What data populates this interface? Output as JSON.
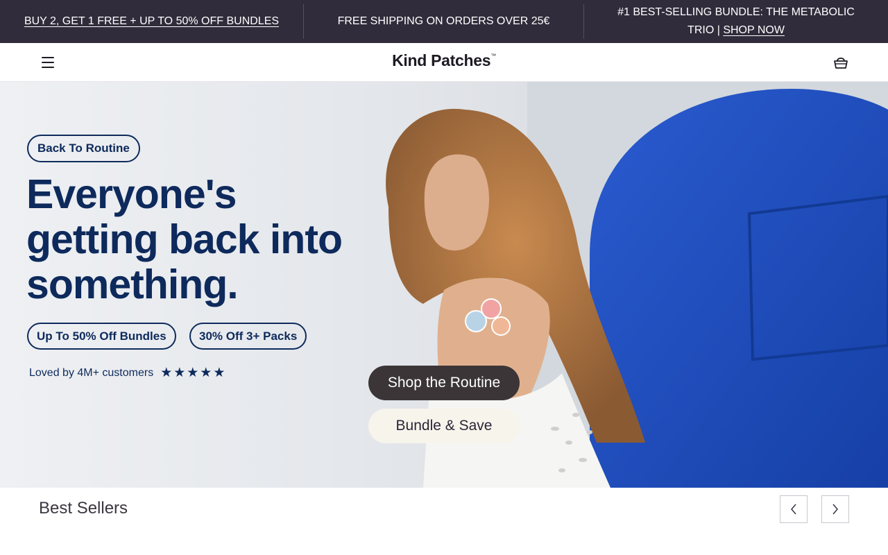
{
  "announcement": {
    "item1": "BUY 2, GET 1 FREE + UP TO 50% OFF BUNDLES",
    "item2": "FREE SHIPPING ON ORDERS OVER 25€",
    "item3_text": "#1 BEST-SELLING BUNDLE: THE METABOLIC TRIO |",
    "item3_link": "SHOP NOW"
  },
  "header": {
    "brand": "Kind Patches",
    "brand_mark": "™",
    "menu_icon": "hamburger-menu-icon",
    "cart_icon": "shopping-basket-icon"
  },
  "hero": {
    "tag": "Back To Routine",
    "headline": "Everyone's getting back into something.",
    "offer1": "Up To 50% Off Bundles",
    "offer2": "30% Off 3+ Packs",
    "loved": "Loved by 4M+ customers",
    "stars": "★★★★★",
    "rating_stars": 5,
    "cta_primary": "Shop the Routine",
    "cta_secondary": "Bundle & Save"
  },
  "best_sellers": {
    "title": "Best Sellers",
    "prev_icon": "chevron-left-icon",
    "next_icon": "chevron-right-icon"
  },
  "colors": {
    "announcement_bg": "#312c3b",
    "brand_navy": "#0e2a5c",
    "cta_primary_bg": "#3b3537",
    "cta_secondary_bg": "#f7f4ec",
    "door_blue": "#1f4fbf"
  }
}
